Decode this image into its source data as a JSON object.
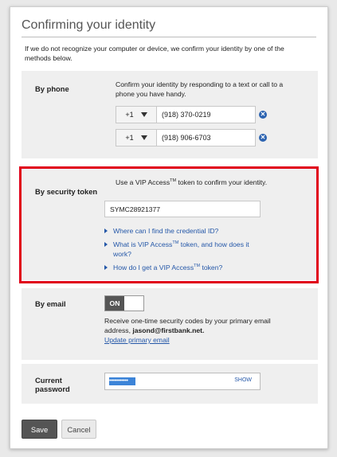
{
  "title": "Confirming your identity",
  "intro": "If we do not recognize your computer or device, we confirm your identity by one of the methods below.",
  "phone": {
    "label": "By phone",
    "description": "Confirm your identity by responding to a text or call to a phone you have handy.",
    "numbers": [
      {
        "country_code": "+1",
        "number": "(918) 370-0219"
      },
      {
        "country_code": "+1",
        "number": "(918) 906-6703"
      }
    ],
    "remove_glyph": "✕"
  },
  "token": {
    "label": "By security token",
    "desc_before": "Use a VIP Access",
    "tm": "TM",
    "desc_after": " token to confirm your identity.",
    "credential_value": "SYMC28921377",
    "links": [
      {
        "text": "Where can I find the credential ID?"
      },
      {
        "text_before": "What is VIP Access",
        "tm": "TM",
        "text_after": " token, and how does it work?"
      },
      {
        "text_before": "How do I get a VIP Access",
        "tm": "TM",
        "text_after": " token?"
      }
    ],
    "highlight_color": "#e0001a"
  },
  "email": {
    "label": "By email",
    "toggle_label": "ON",
    "desc_before": "Receive one-time security codes by your primary email address, ",
    "email_address": "jasond@firstbank.net.",
    "update_link": "Update primary email"
  },
  "password": {
    "label_line1": "Current",
    "label_line2": "password",
    "masked_value": "••••••••••••",
    "show_label": "SHOW"
  },
  "buttons": {
    "save": "Save",
    "cancel": "Cancel"
  },
  "colors": {
    "link": "#2457a8",
    "section_bg": "#efefef",
    "primary_button": "#555555"
  }
}
